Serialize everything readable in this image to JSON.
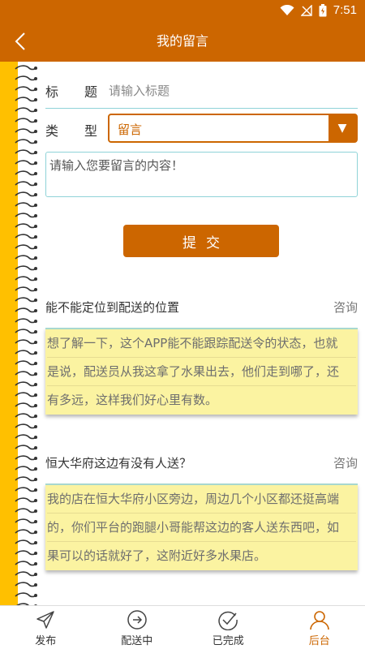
{
  "status_bar": {
    "time": "7:51"
  },
  "header": {
    "title": "我的留言"
  },
  "form": {
    "title_label": "标 题",
    "title_label_a": "标",
    "title_label_b": "题",
    "title_placeholder": "请输入标题",
    "type_label_a": "类",
    "type_label_b": "型",
    "type_value": "留言",
    "content_placeholder": "请输入您要留言的内容！",
    "submit_label": "提交"
  },
  "messages": [
    {
      "title": "能不能定位到配送的位置",
      "tag": "咨询",
      "lines": [
        "想了解一下，这个APP能不能跟踪配送令的状态，也就",
        "是说，配送员从我这拿了水果出去，他们走到哪了，还",
        "有多远，这样我们好心里有数。"
      ]
    },
    {
      "title": "恒大华府这边有没有人送？",
      "tag": "咨询",
      "lines": [
        "我的店在恒大华府小区旁边，周边几个小区都还挺高端",
        "的，你们平台的跑腿小哥能帮这边的客人送东西吧，如",
        "果可以的话就好了，这附近好多水果店。"
      ]
    }
  ],
  "tabs": [
    {
      "label": "发布",
      "icon": "send-icon"
    },
    {
      "label": "配送中",
      "icon": "arrow-circle-icon"
    },
    {
      "label": "已完成",
      "icon": "check-circle-icon"
    },
    {
      "label": "后台",
      "icon": "user-icon",
      "active": true
    }
  ],
  "colors": {
    "primary": "#cc6600",
    "spine": "#ffc000",
    "note": "#fbf3a1"
  }
}
